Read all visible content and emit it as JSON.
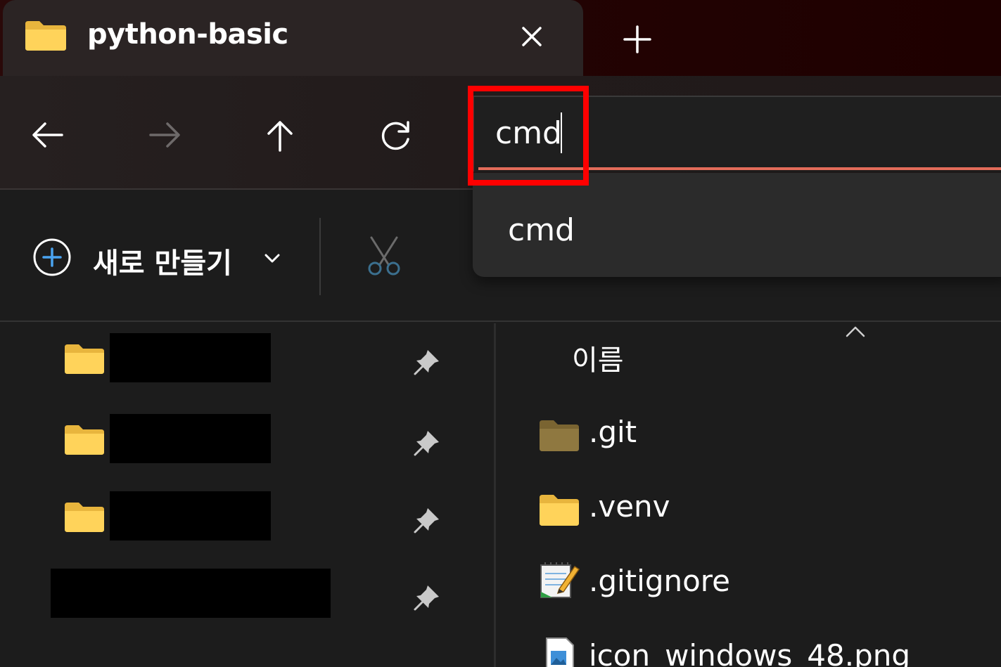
{
  "tab": {
    "title": "python-basic",
    "icon": "folder-icon",
    "close_icon": "close-icon",
    "new_tab_icon": "plus-icon"
  },
  "nav": {
    "back_icon": "arrow-left-icon",
    "forward_icon": "arrow-right-icon",
    "up_icon": "arrow-up-icon",
    "refresh_icon": "refresh-icon"
  },
  "address": {
    "value": "cmd",
    "accent_color": "#e96f5c",
    "highlight_color": "#ff0000"
  },
  "suggestions": [
    {
      "label": "cmd"
    }
  ],
  "commandbar": {
    "new_label": "새로 만들기",
    "new_icon": "plus-circle-icon",
    "new_chevron": "chevron-down-icon",
    "cut_icon": "scissors-icon"
  },
  "quick_access": [
    {
      "icon": "folder-icon",
      "label": "",
      "pinned": true
    },
    {
      "icon": "folder-icon",
      "label": "",
      "pinned": true
    },
    {
      "icon": "folder-icon",
      "label": "",
      "pinned": true
    },
    {
      "icon": "",
      "label": "",
      "pinned": true
    }
  ],
  "filelist": {
    "column_name": "이름",
    "sort_icon": "chevron-up-icon",
    "files": [
      {
        "name": ".git",
        "icon": "folder-dim-icon"
      },
      {
        "name": ".venv",
        "icon": "folder-icon"
      },
      {
        "name": ".gitignore",
        "icon": "notepad-file-icon"
      },
      {
        "name": "icon_windows_48.png",
        "icon": "image-file-icon"
      }
    ]
  }
}
